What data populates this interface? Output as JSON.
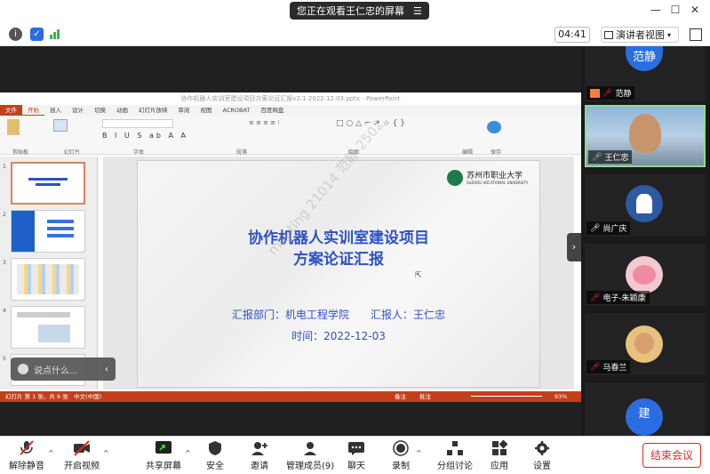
{
  "sharing_banner": {
    "text": "您正在观看王仁忠的屏幕"
  },
  "infobar": {
    "timer": "04:41",
    "view_label": "演讲者视图"
  },
  "ppt": {
    "window_title": "协作机器人实训室建设项目方案论证汇报v2.1 2022.12.03.pptx - PowerPoint",
    "tabs": [
      "文件",
      "开始",
      "插入",
      "设计",
      "切换",
      "动画",
      "幻灯片放映",
      "审阅",
      "视图",
      "ACROBAT",
      "百度网盘"
    ],
    "groups": [
      "剪贴板",
      "幻灯片",
      "字体",
      "段落",
      "绘图",
      "编辑",
      "保存"
    ],
    "slide": {
      "title_line1": "协作机器人实训室建设项目",
      "title_line2": "方案论证汇报",
      "reporter_line": "汇报部门：机电工程学院　　汇报人：王仁忠",
      "date_line": "时间：2022-12-03",
      "logo_text": "苏州市职业大学",
      "logo_sub": "SUZHOU VOCATIONAL UNIVERSITY"
    },
    "thumb_numbers": [
      "1",
      "2",
      "3",
      "4",
      "5"
    ],
    "status_left": "幻灯片 第 1 张，共 9 张　中文(中国)",
    "status_right_notes": "备注",
    "status_right_comments": "批注",
    "zoom": "93%",
    "watermark": "meeting 21014 范静 2502"
  },
  "chat_pill": {
    "placeholder": "说点什么..."
  },
  "participants": [
    {
      "name": "范静",
      "avatar_text": "范静",
      "mic": "muted"
    },
    {
      "name": "王仁忠",
      "mic": "on"
    },
    {
      "name": "尚广庆",
      "mic": "on"
    },
    {
      "name": "电子-朱颖康",
      "mic": "muted"
    },
    {
      "name": "马春兰",
      "mic": "muted"
    },
    {
      "name": "建",
      "avatar_text": "建"
    }
  ],
  "toolbar": {
    "mute": "解除静音",
    "video": "开启视频",
    "share": "共享屏幕",
    "security": "安全",
    "invite": "邀请",
    "members": "管理成员(9)",
    "chat": "聊天",
    "record": "录制",
    "breakout": "分组讨论",
    "apps": "应用",
    "settings": "设置",
    "end": "结束会议"
  },
  "colors": {
    "accent_red": "#e02828",
    "ppt_red": "#c43e1c",
    "slide_blue": "#2d52c4",
    "active_speaker": "#8be08b"
  }
}
